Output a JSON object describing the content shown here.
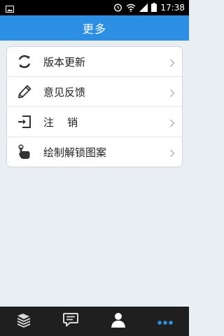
{
  "status_bar": {
    "time": "17:38"
  },
  "header": {
    "title": "更多"
  },
  "menu": {
    "items": [
      {
        "label": "版本更新",
        "icon": "refresh-icon"
      },
      {
        "label": "意见反馈",
        "icon": "pencil-icon"
      },
      {
        "label": "注    销",
        "icon": "logout-icon"
      },
      {
        "label": "绘制解锁图案",
        "icon": "gesture-hand-icon"
      }
    ]
  },
  "bottom_nav": {
    "tabs": [
      {
        "icon": "books-icon",
        "active": false
      },
      {
        "icon": "chat-icon",
        "active": false
      },
      {
        "icon": "person-icon",
        "active": false
      },
      {
        "icon": "more-dots-icon",
        "active": true
      }
    ],
    "active_color": "#2d8fe3",
    "inactive_color": "#d9d9d9"
  },
  "colors": {
    "header": "#2d8fe3",
    "background": "#e9eef2"
  }
}
